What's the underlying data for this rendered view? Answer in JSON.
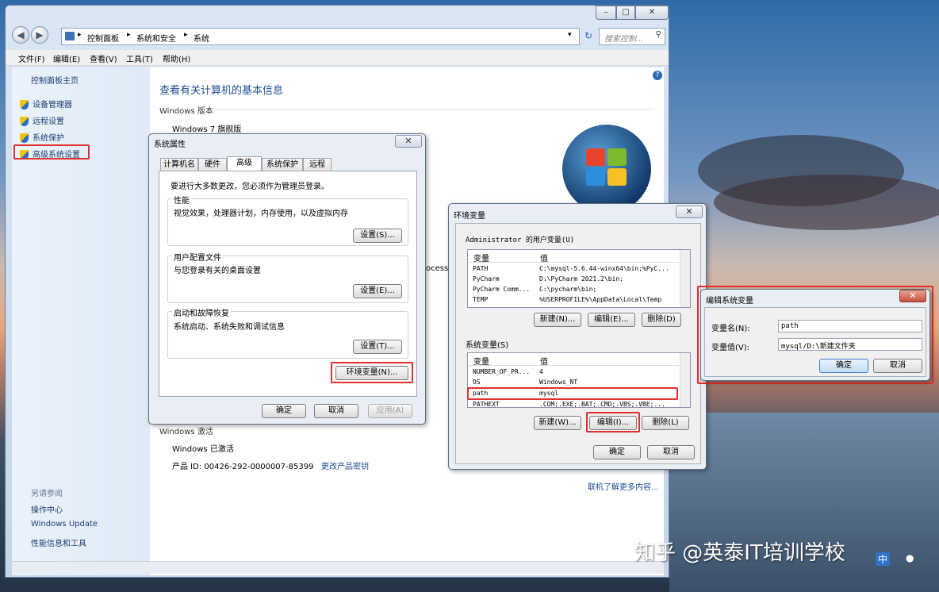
{
  "window": {
    "breadcrumb": [
      "控制面板",
      "系统和安全",
      "系统"
    ],
    "search_placeholder": "搜索控制...",
    "menu": [
      "文件(F)",
      "编辑(E)",
      "查看(V)",
      "工具(T)",
      "帮助(H)"
    ],
    "min": "–",
    "max": "□",
    "close": "✕"
  },
  "sidebar": {
    "home": "控制面板主页",
    "items": [
      "设备管理器",
      "远程设置",
      "系统保护",
      "高级系统设置"
    ],
    "see_also_title": "另请参阅",
    "see_also": [
      "操作中心",
      "Windows Update",
      "性能信息和工具"
    ]
  },
  "content": {
    "heading": "查看有关计算机的基本信息",
    "edition_title": "Windows 版本",
    "edition": "Windows 7 旗舰版",
    "processor_fragment": "ocesso",
    "activation_title": "Windows 激活",
    "activated": "Windows 已激活",
    "product_id": "产品 ID: 00426-292-0000007-85399",
    "change_key": "更改产品密钥",
    "more_info": "联机了解更多内容..."
  },
  "sysprops": {
    "title": "系统属性",
    "tabs": [
      "计算机名",
      "硬件",
      "高级",
      "系统保护",
      "远程"
    ],
    "admin_note": "要进行大多数更改，您必须作为管理员登录。",
    "perf_title": "性能",
    "perf_desc": "视觉效果，处理器计划，内存使用，以及虚拟内存",
    "profile_title": "用户配置文件",
    "profile_desc": "与您登录有关的桌面设置",
    "startup_title": "启动和故障恢复",
    "startup_desc": "系统启动、系统失败和调试信息",
    "settings_s": "设置(S)...",
    "settings_e": "设置(E)...",
    "settings_t": "设置(T)...",
    "env_button": "环境变量(N)...",
    "ok": "确定",
    "cancel": "取消",
    "apply": "应用(A)"
  },
  "envvars": {
    "title": "环境变量",
    "user_title": "Administrator 的用户变量(U)",
    "col_var": "变量",
    "col_val": "值",
    "user_rows": [
      {
        "name": "PATH",
        "value": "C:\\mysql-5.6.44-winx64\\bin;%PyC..."
      },
      {
        "name": "PyCharm",
        "value": "D:\\PyCharm 2021.2\\bin;"
      },
      {
        "name": "PyCharm Comm...",
        "value": "C:\\pycharm\\bin;"
      },
      {
        "name": "TEMP",
        "value": "%USERPROFILE%\\AppData\\Local\\Temp"
      }
    ],
    "user_new": "新建(N)...",
    "user_edit": "编辑(E)...",
    "user_delete": "删除(D)",
    "sys_title": "系统变量(S)",
    "sys_rows": [
      {
        "name": "NUMBER_OF_PR...",
        "value": "4"
      },
      {
        "name": "OS",
        "value": "Windows_NT"
      },
      {
        "name": "path",
        "value": "mysql"
      },
      {
        "name": "PATHEXT",
        "value": ".COM;.EXE;.BAT;.CMD;.VBS;.VBE;..."
      }
    ],
    "sys_new": "新建(W)...",
    "sys_edit": "编辑(I)...",
    "sys_delete": "删除(L)",
    "ok": "确定",
    "cancel": "取消"
  },
  "editvar": {
    "title": "编辑系统变量",
    "name_label": "变量名(N):",
    "name_value": "path",
    "value_label": "变量值(V):",
    "value_value": "mysql/D:\\新建文件夹",
    "ok": "确定",
    "cancel": "取消"
  },
  "watermark": "知乎 @英泰IT培训学校",
  "tray": "中",
  "colors": {
    "highlight_red": "#e0312c",
    "link_blue": "#1e4f95"
  }
}
